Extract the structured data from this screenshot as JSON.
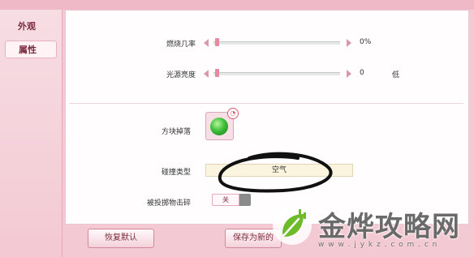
{
  "sidebar": {
    "tabs": [
      {
        "label": "外观"
      },
      {
        "label": "属性"
      }
    ]
  },
  "settings": {
    "burn_rate": {
      "label": "燃烧几率",
      "value_text": "0%"
    },
    "light_brightness": {
      "label": "光源亮度",
      "value_text": "0",
      "level_text": "低"
    },
    "block_drop": {
      "label": "方块掉落"
    },
    "collision_type": {
      "label": "碰撞类型",
      "value": "空气"
    },
    "projectile_break": {
      "label": "被投掷物击碎",
      "toggle_text": "关"
    }
  },
  "buttons": {
    "reset": "恢复默认",
    "save_new": "保存为新的"
  },
  "watermark": {
    "title": "金烨攻略网",
    "url": "w w w . j y k z . c o m . c n"
  },
  "colors": {
    "accent": "#e78aa0",
    "background": "#f3c9d3",
    "panel": "#fffdfd",
    "scribble": "#111111"
  },
  "icons": {
    "drop_item": "green-orb-icon",
    "badge": "pie-badge-icon",
    "watermark_logo": "leaf-plug-icon"
  }
}
